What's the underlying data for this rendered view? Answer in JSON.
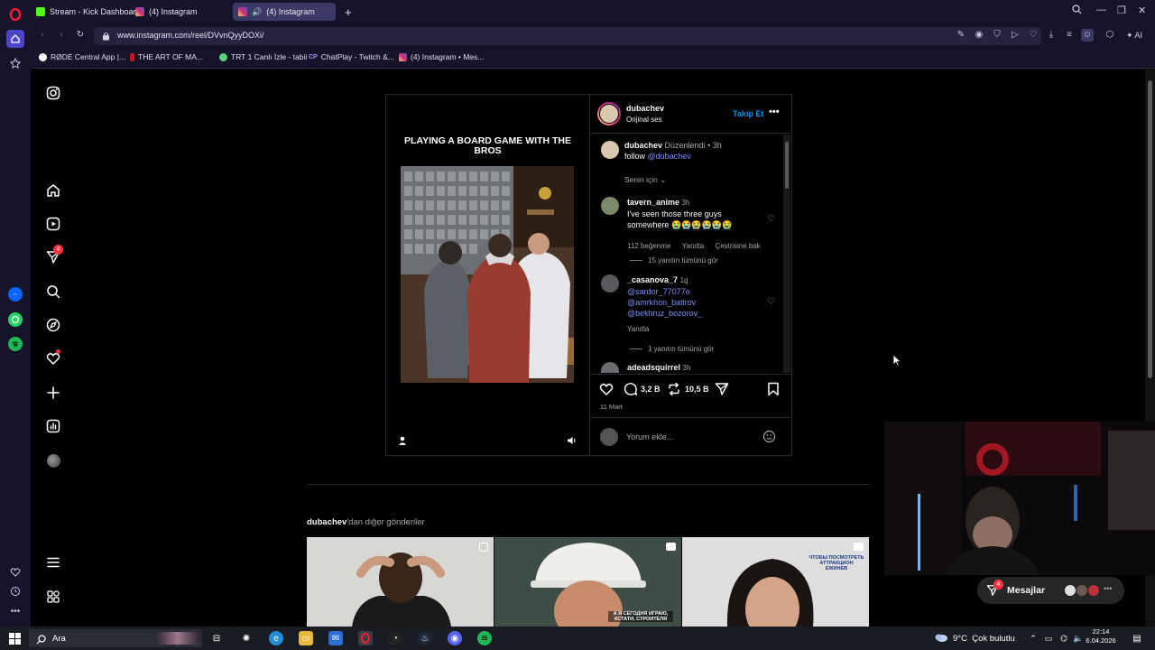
{
  "browser": {
    "tabs": [
      {
        "label": "Stream - Kick Dashboard",
        "active": false
      },
      {
        "label": "(4) Instagram",
        "active": false
      },
      {
        "label": "(4) Instagram",
        "active": true
      }
    ],
    "url": "www.instagram.com/reel/DVvnQyyDOXi/",
    "ai_label": "AI",
    "bookmarks": [
      {
        "label": "RØDE Central App |..."
      },
      {
        "label": "THE ART OF MA..."
      },
      {
        "label": "TRT 1 Canlı İzle - tabii"
      },
      {
        "label": "ChatPlay - Twitch &..."
      },
      {
        "label": "(4) Instagram • Mes..."
      }
    ]
  },
  "sidebar": {
    "notification_count": "4"
  },
  "post": {
    "author": "dubachev",
    "audio": "Orijinal ses",
    "follow_label": "Takip Et",
    "video_caption": "PLAYING A BOARD GAME WITH THE BROS",
    "caption": {
      "user": "dubachev",
      "edited": "Düzenlendi",
      "time": "3h",
      "text_prefix": "follow",
      "mention": "@dubachev"
    },
    "filter_label": "Senin için",
    "comments": [
      {
        "user": "tavern_anime",
        "time": "3h",
        "text": "I've seen those three guys somewhere 😭😭😭😭😭😭",
        "likes": "112 beğenme",
        "reply": "Yanıtla",
        "translate": "Çevirisine bak",
        "replies": "15 yanıtın tümünü gör"
      },
      {
        "user": "_casanova_7",
        "time": "1g",
        "mentions": [
          "@sardor_77077o",
          "@amrkhon_batirov",
          "@bekhruz_bozorov_"
        ],
        "reply": "Yanıtla",
        "replies": "1 yanıtın tümünü gör"
      },
      {
        "user": "adeadsquirrel",
        "time": "3h"
      }
    ],
    "comment_count": "3,2 B",
    "repost_count": "10,5 B",
    "date": "11 Mart",
    "comment_placeholder": "Yorum ekle..."
  },
  "more_posts": {
    "title_user": "dubachev",
    "title_suffix": "'dan diğer gönderiler",
    "thumbs": [
      {
        "overlay": ""
      },
      {
        "overlay": "А Я СЕГОДНЯ ИГРАЮ, КСТАТИ, СТРОИТЕЛЯ"
      },
      {
        "overlay": "ЧТОБЫ ПОСМОТРЕТЬ АТТРАКЦИОН ЕЖИНЕВ"
      }
    ]
  },
  "messages": {
    "label": "Mesajlar",
    "badge": "4"
  },
  "taskbar": {
    "search_label": "Ara",
    "weather": "9°C  Çok bulutlu",
    "time": "22:14",
    "date": "6.04.2026"
  },
  "colors": {
    "opera_bg": "#16142a",
    "ig_blue": "#0095f6",
    "link_blue": "#7d8efb",
    "badge_red": "#ff3040"
  }
}
